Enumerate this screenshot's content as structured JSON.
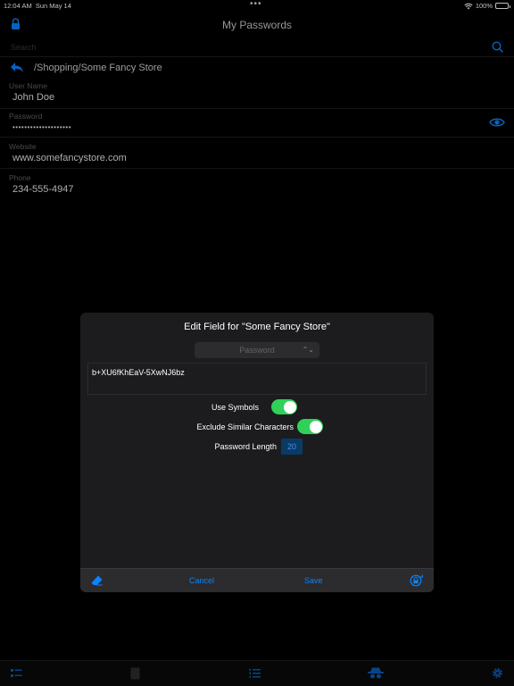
{
  "status": {
    "time": "12:04 AM",
    "date": "Sun May 14",
    "dots": "•••",
    "battery": "100%",
    "battery_level": 1.0
  },
  "nav": {
    "title": "My Passwords"
  },
  "search": {
    "placeholder": "Search"
  },
  "path": "/Shopping/Some Fancy Store",
  "fields": [
    {
      "label": "User Name",
      "value": "John Doe"
    },
    {
      "label": "Password",
      "value": "••••••••••••••••••••"
    },
    {
      "label": "Website",
      "value": "www.somefancystore.com"
    },
    {
      "label": "Phone",
      "value": "234-555-4947"
    }
  ],
  "dialog": {
    "title": "Edit Field for \"Some Fancy Store\"",
    "field_type": "Password",
    "generated_value": "b+XU6fKhEaV-5XwNJ6bz",
    "use_symbols_label": "Use Symbols",
    "use_symbols": true,
    "exclude_similar_label": "Exclude Similar Characters",
    "exclude_similar": true,
    "length_label": "Password Length",
    "length_value": "20",
    "cancel_label": "Cancel",
    "save_label": "Save"
  },
  "colors": {
    "accent": "#0a84ff",
    "toggle_on": "#30d158",
    "background": "#000000",
    "dialog_bg": "#1c1c1e"
  },
  "icons": {
    "nav_left": "lock-icon",
    "search": "search-icon",
    "back": "back-arrow-icon",
    "reveal": "eye-icon",
    "dialog_left": "eraser-icon",
    "dialog_right": "lock-generate-icon",
    "tabs": [
      "list-icon",
      "document-icon",
      "numbered-list-icon",
      "spy-icon",
      "gear-icon"
    ]
  }
}
